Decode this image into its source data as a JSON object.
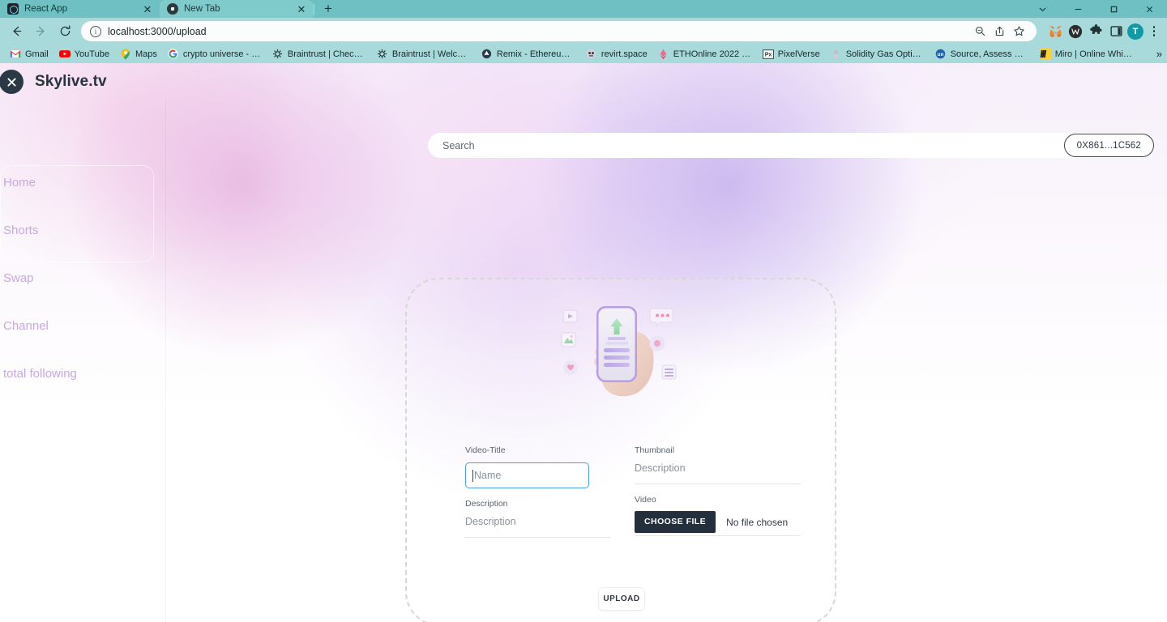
{
  "browser": {
    "tabs": [
      {
        "title": "React App",
        "favicon": "react-icon",
        "active": false
      },
      {
        "title": "New Tab",
        "favicon": "chrome-icon",
        "active": true
      }
    ],
    "new_tab_label": "+",
    "window_controls": [
      "chevron-down-icon",
      "minimize-icon",
      "maximize-icon",
      "close-icon"
    ],
    "nav": {
      "back": "back-arrow-icon",
      "forward": "forward-arrow-icon",
      "reload": "reload-icon"
    },
    "omnibox": {
      "url": "localhost:3000/upload",
      "info_icon": "i",
      "actions": [
        "zoom-out-icon",
        "share-icon",
        "bookmark-star-icon"
      ]
    },
    "extensions": [
      "metamask-icon",
      "wallet-icon",
      "puzzle-piece-icon",
      "side-panel-icon"
    ],
    "profile_initial": "T",
    "menu_icon": "kebab-menu-icon",
    "bookmarks": [
      {
        "label": "Gmail",
        "icon": "gmail-icon"
      },
      {
        "label": "YouTube",
        "icon": "youtube-icon"
      },
      {
        "label": "Maps",
        "icon": "maps-icon"
      },
      {
        "label": "crypto universe - Goo...",
        "icon": "google-icon"
      },
      {
        "label": "Braintrust | Check you...",
        "icon": "braintrust-icon"
      },
      {
        "label": "Braintrust | Welcome",
        "icon": "braintrust-icon"
      },
      {
        "label": "Remix - Ethereum IDE",
        "icon": "remix-icon"
      },
      {
        "label": "revirt.space",
        "icon": "revirt-icon"
      },
      {
        "label": "ETHOnline 2022 Info...",
        "icon": "eth-icon"
      },
      {
        "label": "PixelVerse",
        "icon": "pixelverse-icon"
      },
      {
        "label": "Solidity Gas Optimiza...",
        "icon": "solidity-icon"
      },
      {
        "label": "Source, Assess & Hire...",
        "icon": "un-icon"
      },
      {
        "label": "Miro | Online Whiteb...",
        "icon": "miro-icon"
      }
    ],
    "bookmarks_overflow": "»"
  },
  "app": {
    "brand": "Skylive.tv",
    "logo_icon": "close-x-icon",
    "search": {
      "placeholder": "Search"
    },
    "wallet": {
      "address": "0X861...1C562"
    },
    "sidebar": {
      "items": [
        {
          "label": "Home"
        },
        {
          "label": "Shorts"
        },
        {
          "label": "Swap"
        },
        {
          "label": "Channel"
        },
        {
          "label": "total following"
        }
      ]
    },
    "upload": {
      "illustration": "hand-holding-phone-upload-illustration",
      "fields": {
        "video_title_label": "Video-Title",
        "video_title_placeholder": "Name",
        "description_label": "Description",
        "description_placeholder": "Description",
        "thumbnail_label": "Thumbnail",
        "thumbnail_placeholder": "Description",
        "video_label": "Video",
        "choose_file_label": "CHOOSE FILE",
        "file_status": "No file chosen"
      },
      "submit_label": "UPLOAD"
    }
  },
  "colors": {
    "browser_chrome": "#a8dadb",
    "tab_active": "#7fcbcc",
    "accent_purple": "#c9a8e0",
    "dark_button": "#232f3c",
    "focus_blue": "#4a9df0"
  }
}
